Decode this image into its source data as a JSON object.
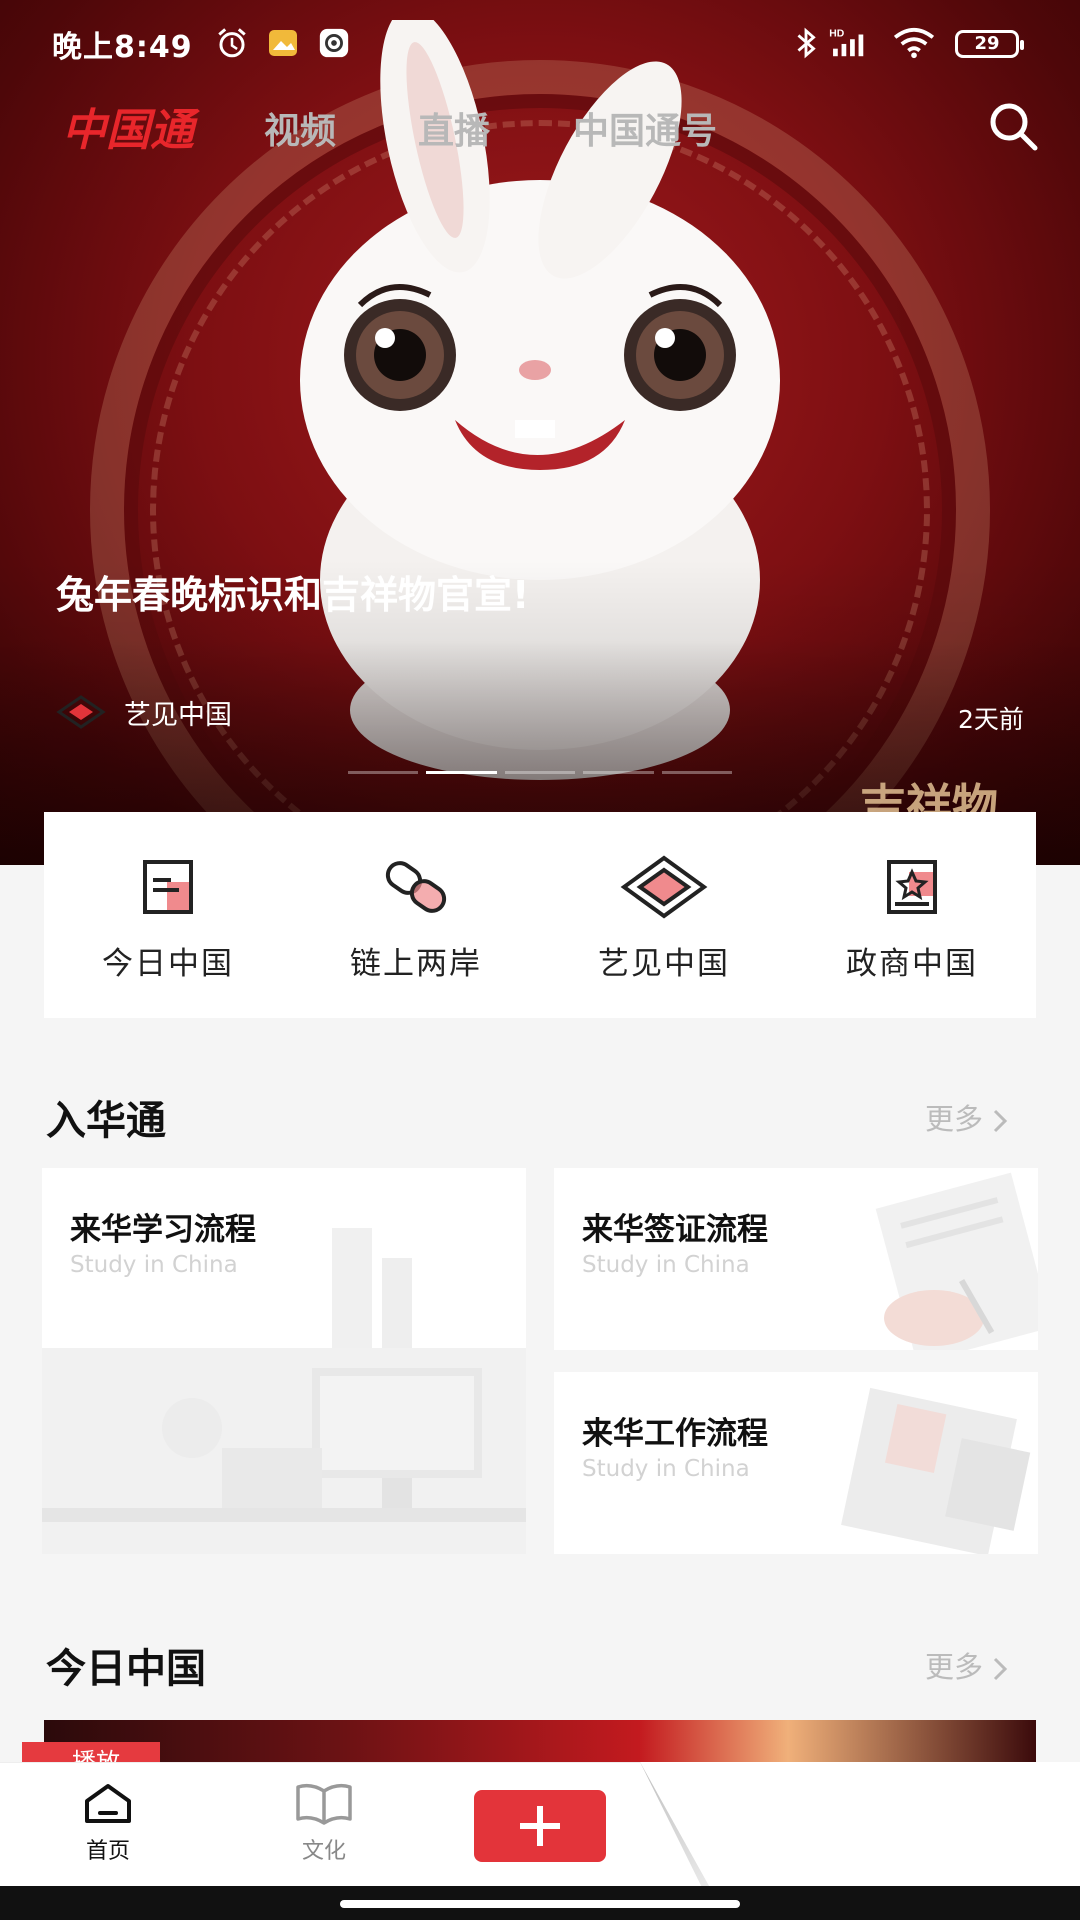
{
  "status_bar": {
    "time": "晚上8:49",
    "battery": "29",
    "icons": [
      "alarm-icon",
      "gallery-icon",
      "settings-icon",
      "bluetooth-icon",
      "signal-icon",
      "wifi-icon",
      "battery-icon"
    ]
  },
  "top_nav": {
    "logo": "中国通",
    "tabs": [
      "视频",
      "直播",
      "中国通号"
    ],
    "search_icon": "search-icon"
  },
  "hero": {
    "title": "兔年春晚标识和吉祥物官宣!",
    "source": "艺见中国",
    "time_ago": "2天前",
    "stamp": "吉祥物",
    "slide_count": 5,
    "active_slide": 1
  },
  "channels": [
    {
      "label": "今日中国",
      "icon": "document-icon"
    },
    {
      "label": "链上两岸",
      "icon": "link-icon"
    },
    {
      "label": "艺见中国",
      "icon": "diamond-pattern-icon"
    },
    {
      "label": "政商中国",
      "icon": "star-frame-icon"
    }
  ],
  "section_ruhua": {
    "title": "入华通",
    "more": "更多",
    "cards": [
      {
        "title": "来华学习流程",
        "subtitle": "Study in China"
      },
      {
        "title": "来华签证流程",
        "subtitle": "Study in China"
      },
      {
        "title": "来华工作流程",
        "subtitle": "Study in China"
      }
    ]
  },
  "section_today": {
    "title": "今日中国",
    "more": "更多",
    "badge": "播放"
  },
  "bottom_nav": {
    "items": [
      {
        "label": "首页",
        "icon": "home-icon"
      },
      {
        "label": "文化",
        "icon": "book-icon"
      }
    ],
    "add_icon": "plus-icon"
  },
  "colors": {
    "brand_red": "#e3343a",
    "logo_red": "#e8262b",
    "muted_gray": "#bbbbbb"
  }
}
